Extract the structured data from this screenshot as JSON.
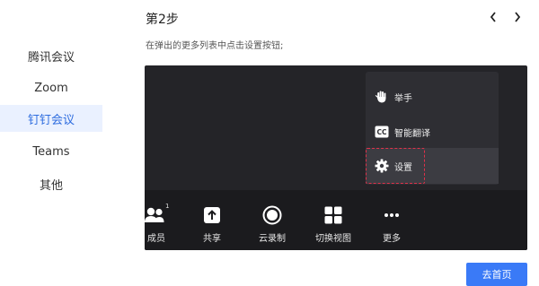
{
  "sidebar": {
    "items": [
      {
        "label": "腾讯会议",
        "active": false
      },
      {
        "label": "Zoom",
        "active": false
      },
      {
        "label": "钉钉会议",
        "active": true
      },
      {
        "label": "Teams",
        "active": false
      },
      {
        "label": "其他",
        "active": false
      }
    ]
  },
  "header": {
    "step_title": "第2步",
    "instruction": "在弹出的更多列表中点击设置按钮;",
    "prev_icon": "chevron-left-icon",
    "next_icon": "chevron-right-icon"
  },
  "meeting": {
    "popup_menu": [
      {
        "label": "举手",
        "icon": "raise-hand-icon"
      },
      {
        "label": "智能翻译",
        "icon": "cc-icon"
      },
      {
        "label": "设置",
        "icon": "gear-icon",
        "highlighted": true
      }
    ],
    "toolbar": {
      "members_count": "1",
      "buttons": [
        {
          "label": "成员",
          "icon": "members-icon"
        },
        {
          "label": "共享",
          "icon": "share-icon"
        },
        {
          "label": "云录制",
          "icon": "record-icon"
        },
        {
          "label": "切换视图",
          "icon": "grid-view-icon"
        },
        {
          "label": "更多",
          "icon": "more-icon"
        }
      ]
    }
  },
  "footer": {
    "home_button": "去首页"
  },
  "colors": {
    "accent": "#3a7af7",
    "active_text": "#2d6cdf",
    "active_bg": "#eaf1ff",
    "highlight_border": "#e0314a"
  }
}
